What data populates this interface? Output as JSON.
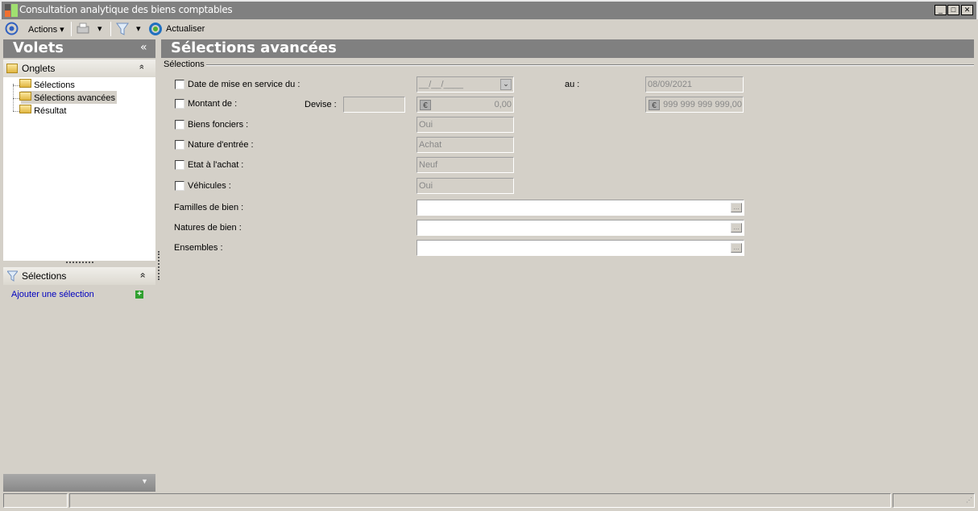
{
  "window": {
    "title": "Consultation analytique des biens comptables"
  },
  "toolbar": {
    "actions": "Actions",
    "refresh": "Actualiser"
  },
  "left": {
    "volets": "Volets",
    "collapse": "«",
    "onglets": "Onglets",
    "expand": "»",
    "tree": [
      "Sélections",
      "Sélections avancées",
      "Résultat"
    ],
    "selections_title": "Sélections",
    "add_selection": "Ajouter une sélection"
  },
  "main": {
    "title": "Sélections avancées",
    "group": "Sélections",
    "date_label": "Date de mise en service du :",
    "date_from": "__/__/____",
    "au": "au :",
    "date_to": "08/09/2021",
    "montant_label": "Montant de :",
    "devise": "Devise :",
    "devise_value": "",
    "montant_from": "0,00",
    "montant_to": "999 999 999 999,00",
    "biens_fonciers": "Biens fonciers :",
    "biens_fonciers_value": "Oui",
    "nature_entree": "Nature d'entrée :",
    "nature_entree_value": "Achat",
    "etat_achat": "Etat à l'achat :",
    "etat_achat_value": "Neuf",
    "vehicules": "Véhicules :",
    "vehicules_value": "Oui",
    "familles": "Familles de bien :",
    "natures": "Natures de bien :",
    "ensembles": "Ensembles :",
    "ellipsis": "..."
  }
}
